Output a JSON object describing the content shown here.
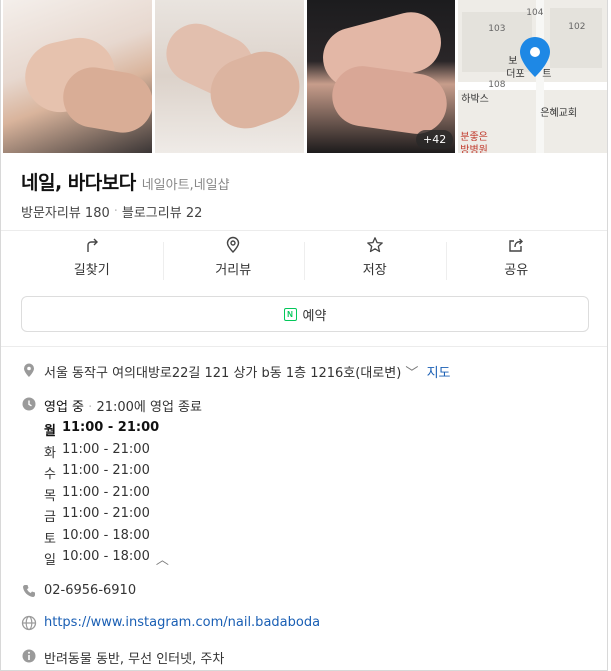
{
  "photos": {
    "more_count": "+42",
    "map_labels": [
      "103",
      "104",
      "102",
      "108",
      "보",
      "더포",
      "트",
      "하박스",
      "은혜교회",
      "분좋은",
      "방병원"
    ]
  },
  "place": {
    "name": "네일, 바다보다",
    "category": "네일아트,네일샵",
    "visitor_reviews": "방문자리뷰 180",
    "blog_reviews": "블로그리뷰 22"
  },
  "actions": [
    {
      "label": "길찾기",
      "icon": "directions-icon"
    },
    {
      "label": "거리뷰",
      "icon": "street-view-icon"
    },
    {
      "label": "저장",
      "icon": "star-icon"
    },
    {
      "label": "공유",
      "icon": "share-icon"
    }
  ],
  "reserve": {
    "label": "예약",
    "icon": "naver-booking-icon"
  },
  "address": {
    "text": "서울 동작구 여의대방로22길 121 상가 b동 1층 1216호(대로변)",
    "map_link": "지도"
  },
  "hours": {
    "status": "영업 중",
    "status_detail": "21:00에 영업 종료",
    "days": [
      {
        "day": "월",
        "time": "11:00 - 21:00"
      },
      {
        "day": "화",
        "time": "11:00 - 21:00"
      },
      {
        "day": "수",
        "time": "11:00 - 21:00"
      },
      {
        "day": "목",
        "time": "11:00 - 21:00"
      },
      {
        "day": "금",
        "time": "11:00 - 21:00"
      },
      {
        "day": "토",
        "time": "10:00 - 18:00"
      },
      {
        "day": "일",
        "time": "10:00 - 18:00"
      }
    ]
  },
  "phone": "02-6956-6910",
  "website": "https://www.instagram.com/nail.badaboda",
  "amenities": "반려동물 동반, 무선 인터넷, 주차",
  "colors": {
    "accent_blue": "#1a5fb4",
    "naver_green": "#03c75a",
    "pin_blue": "#1e88e5"
  }
}
